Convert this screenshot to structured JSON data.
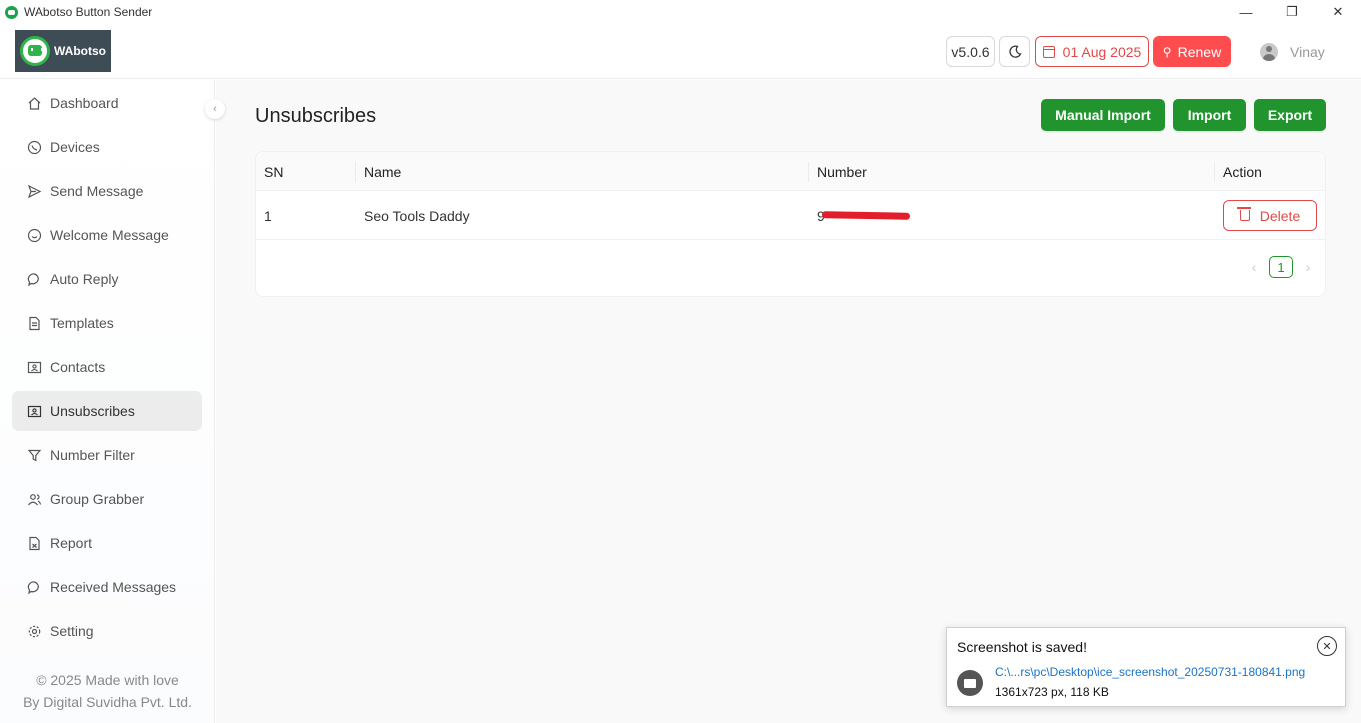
{
  "window": {
    "title": "WAbotso Button Sender",
    "controls": [
      "—",
      "❐",
      "✕"
    ]
  },
  "header": {
    "logo_text": "WAbotso",
    "version": "v5.0.6",
    "theme_icon": "moon-icon",
    "date": "01 Aug 2025",
    "renew_label": "Renew",
    "user_name": "Vinay"
  },
  "sidebar": {
    "items": [
      {
        "label": "Dashboard",
        "icon": "home-icon"
      },
      {
        "label": "Devices",
        "icon": "whatsapp-icon"
      },
      {
        "label": "Send Message",
        "icon": "send-icon"
      },
      {
        "label": "Welcome Message",
        "icon": "smile-icon"
      },
      {
        "label": "Auto Reply",
        "icon": "chat-icon"
      },
      {
        "label": "Templates",
        "icon": "document-icon"
      },
      {
        "label": "Contacts",
        "icon": "contacts-icon"
      },
      {
        "label": "Unsubscribes",
        "icon": "contacts-icon",
        "active": true
      },
      {
        "label": "Number Filter",
        "icon": "filter-icon"
      },
      {
        "label": "Group Grabber",
        "icon": "group-icon"
      },
      {
        "label": "Report",
        "icon": "report-icon"
      },
      {
        "label": "Received Messages",
        "icon": "chat-icon"
      },
      {
        "label": "Setting",
        "icon": "gear-icon"
      }
    ],
    "footer_line1": "© 2025 Made with love",
    "footer_line2": "By Digital Suvidha Pvt. Ltd."
  },
  "main": {
    "title": "Unsubscribes",
    "buttons": {
      "manual_import": "Manual Import",
      "import": "Import",
      "export": "Export"
    },
    "table": {
      "columns": [
        "SN",
        "Name",
        "Number",
        "Action"
      ],
      "rows": [
        {
          "sn": "1",
          "name": "Seo Tools Daddy",
          "number": "9",
          "action": "Delete"
        }
      ]
    },
    "pagination": {
      "current": "1"
    }
  },
  "toast": {
    "title": "Screenshot is saved!",
    "path": "C:\\...rs\\pc\\Desktop\\ice_screenshot_20250731-180841.png",
    "meta": "1361x723 px, 118 KB"
  },
  "colors": {
    "accent_green": "#21942d",
    "danger_red": "#ff4d4f",
    "sidebar_active": "#ececec"
  }
}
